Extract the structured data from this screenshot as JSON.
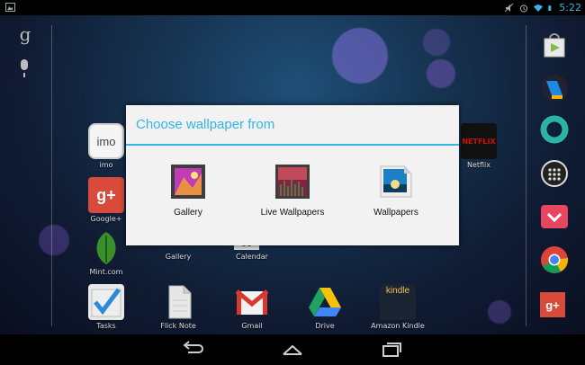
{
  "status_bar": {
    "time": "5:22",
    "icons": [
      "picture-notification-icon",
      "mute-icon",
      "alarm-icon",
      "wifi-icon",
      "battery-icon"
    ]
  },
  "search": {
    "google_glyph": "g",
    "icons": [
      "google-search-icon",
      "voice-search-icon"
    ]
  },
  "home_apps": [
    {
      "label": "imo",
      "icon": "imo-icon",
      "icon_text": "imo"
    },
    {
      "label": "Google+",
      "icon": "google-plus-icon",
      "icon_text": "g+"
    },
    {
      "label": "Mint.com",
      "icon": "mint-icon"
    },
    {
      "label": "Gallery",
      "icon": "gallery-icon"
    },
    {
      "label": "Calendar",
      "icon": "calendar-icon",
      "icon_text": "31"
    },
    {
      "label": "Netflix",
      "icon": "netflix-icon",
      "icon_text": "NETFLIX"
    },
    {
      "label": "Tasks",
      "icon": "tasks-icon"
    },
    {
      "label": "Flick Note",
      "icon": "flick-note-icon"
    },
    {
      "label": "Gmail",
      "icon": "gmail-icon"
    },
    {
      "label": "Drive",
      "icon": "drive-icon"
    },
    {
      "label": "Amazon Kindle",
      "icon": "kindle-icon",
      "icon_text": "kindle"
    }
  ],
  "dock": [
    {
      "icon": "play-store-icon"
    },
    {
      "icon": "play-books-icon"
    },
    {
      "icon": "ring-app-icon"
    },
    {
      "icon": "all-apps-icon"
    },
    {
      "icon": "pocket-icon"
    },
    {
      "icon": "chrome-icon"
    },
    {
      "icon": "google-plus-dock-icon",
      "icon_text": "g+"
    }
  ],
  "dialog": {
    "title": "Choose wallpaper from",
    "options": [
      {
        "label": "Gallery",
        "icon": "gallery-icon"
      },
      {
        "label": "Live Wallpapers",
        "icon": "live-wallpapers-icon"
      },
      {
        "label": "Wallpapers",
        "icon": "wallpapers-icon"
      }
    ]
  },
  "nav_bar": {
    "buttons": [
      "back-icon",
      "home-icon",
      "recent-apps-icon"
    ]
  },
  "colors": {
    "accent": "#33b5e5",
    "dialog_bg": "#f2f2f2"
  }
}
